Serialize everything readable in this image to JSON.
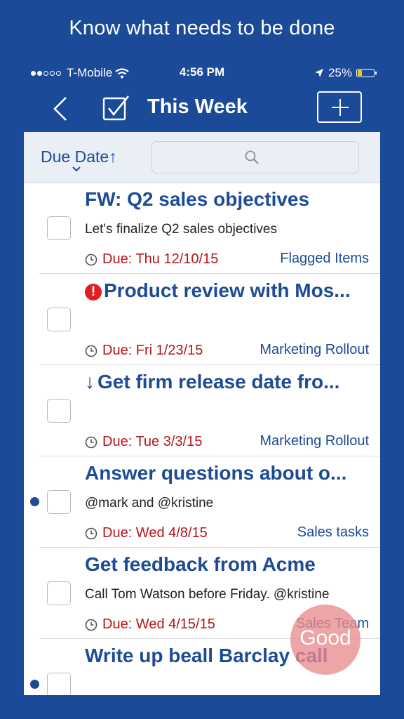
{
  "promo_text": "Know what needs to be done",
  "status_bar": {
    "carrier": "T-Mobile",
    "time": "4:56 PM",
    "battery": "25%",
    "battery_level": 0.25,
    "signal_bars_filled": 2,
    "signal_bars_total": 5
  },
  "nav": {
    "title": "This Week",
    "back_icon": "chevron-left-icon",
    "task_icon": "checkbox-icon",
    "add_icon": "plus-icon"
  },
  "filter": {
    "sort_label": "Due Date",
    "sort_arrow": "↑",
    "search_placeholder": ""
  },
  "tasks": [
    {
      "title": "FW: Q2 sales objectives",
      "preview": "Let's finalize Q2 sales objectives",
      "due": "Due: Thu 12/10/15",
      "folder": "Flagged Items",
      "priority": "none",
      "unread": false
    },
    {
      "title": "Product review with Mos...",
      "preview": "",
      "due": "Due: Fri 1/23/15",
      "folder": "Marketing Rollout",
      "priority": "high",
      "priority_mark": "!",
      "unread": false
    },
    {
      "title": "Get firm release date fro...",
      "preview": "",
      "due": "Due: Tue 3/3/15",
      "folder": "Marketing Rollout",
      "priority": "low",
      "priority_mark": "↓",
      "unread": false
    },
    {
      "title": "Answer questions about o...",
      "preview": "@mark and @kristine",
      "due": "Due: Wed 4/8/15",
      "folder": "Sales tasks",
      "priority": "none",
      "unread": true
    },
    {
      "title": "Get feedback from Acme",
      "preview": "Call Tom Watson before Friday. @kristine",
      "due": "Due: Wed 4/15/15",
      "folder": "Sales Team",
      "priority": "none",
      "unread": false
    },
    {
      "title": "Write up beall Barclay call",
      "preview": "",
      "due": "",
      "folder": "",
      "priority": "none",
      "unread": true
    }
  ],
  "badge": {
    "label": "Good"
  },
  "colors": {
    "brand_blue": "#1b4a99",
    "link_blue": "#1d4b96",
    "due_red": "#b5151b",
    "priority_red": "#e02020",
    "badge_pink": "#e88c8c"
  }
}
